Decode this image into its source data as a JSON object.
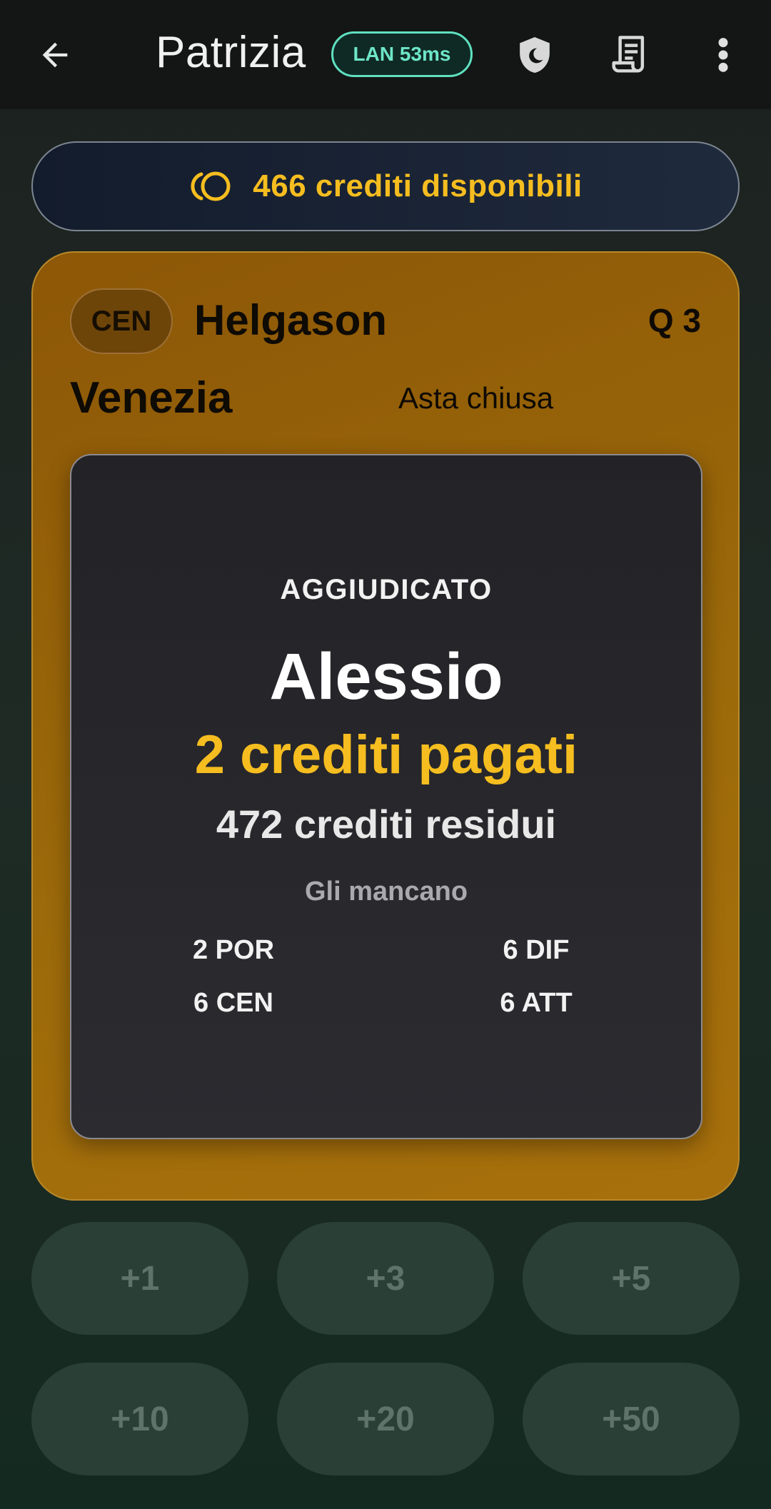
{
  "header": {
    "title": "Patrizia",
    "connection_badge": "LAN 53ms",
    "icons": [
      "back-arrow-icon",
      "shield-moon-icon",
      "receipt-icon",
      "more-vert-icon"
    ]
  },
  "credits": {
    "text": "466 crediti disponibili",
    "icon": "coins-icon",
    "color": "#f5bd1f"
  },
  "auction": {
    "role": "CEN",
    "player": "Helgason",
    "quota": "Q 3",
    "team": "Venezia",
    "status": "Asta chiusa",
    "card_color": "#9c6a0a",
    "result": {
      "label": "AGGIUDICATO",
      "winner": "Alessio",
      "paid": "2 crediti pagati",
      "residual": "472 crediti residui",
      "missing_label": "Gli mancano",
      "missing": [
        "2 POR",
        "6 DIF",
        "6 CEN",
        "6 ATT"
      ]
    }
  },
  "bid_buttons": [
    "+1",
    "+3",
    "+5",
    "+10",
    "+20",
    "+50"
  ]
}
